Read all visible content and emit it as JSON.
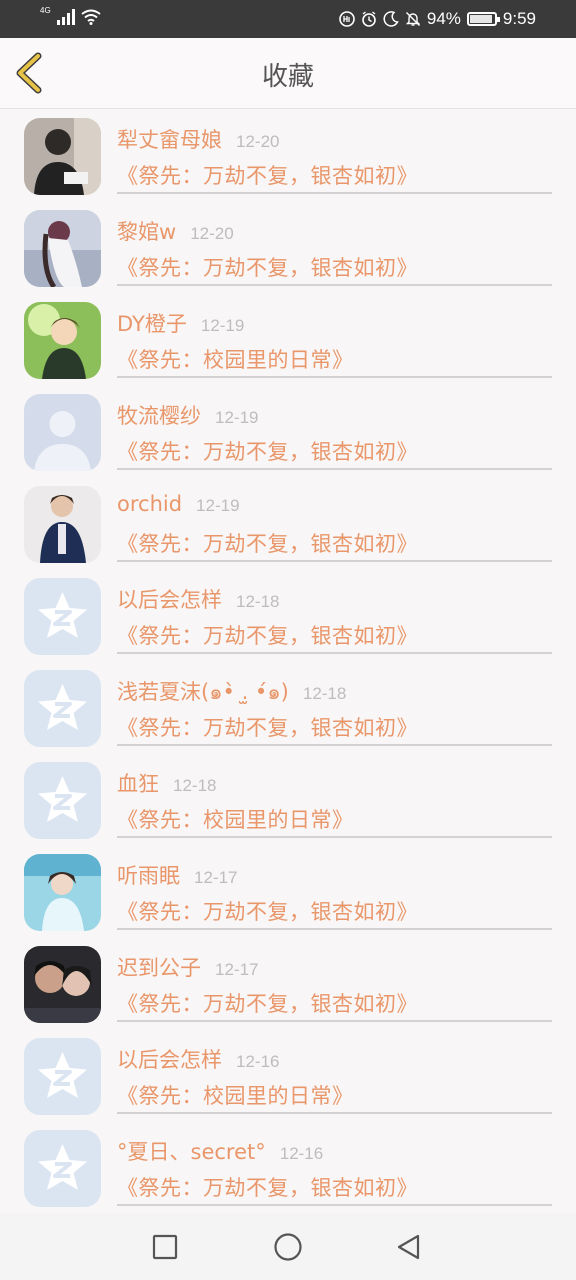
{
  "status_bar": {
    "network": "4G",
    "battery_percent": "94%",
    "battery_level": 0.94,
    "time": "9:59",
    "icons": [
      "signal-icon",
      "wifi-icon",
      "hd-icon",
      "alarm-icon",
      "moon-icon",
      "bell-off-icon",
      "battery-icon"
    ]
  },
  "header": {
    "title": "收藏",
    "back_icon": "chevron-left-icon",
    "accent_color": "#e6c248"
  },
  "favorites": [
    {
      "nickname": "犁丈畲母娘",
      "date": "12-20",
      "message": "《祭先：万劫不复，银杏如初》",
      "avatar": "photo-boy-desk"
    },
    {
      "nickname": "黎婠w",
      "date": "12-20",
      "message": "《祭先：万劫不复，银杏如初》",
      "avatar": "photo-girl-flower"
    },
    {
      "nickname": "DY橙子",
      "date": "12-19",
      "message": "《祭先：校园里的日常》",
      "avatar": "photo-anime-green"
    },
    {
      "nickname": "牧流樱纱",
      "date": "12-19",
      "message": "《祭先：万劫不复，银杏如初》",
      "avatar": "default-silhouette"
    },
    {
      "nickname": "orchid",
      "date": "12-19",
      "message": "《祭先：万劫不复，银杏如初》",
      "avatar": "photo-boy-jacket"
    },
    {
      "nickname": "以后会怎样",
      "date": "12-18",
      "message": "《祭先：万劫不复，银杏如初》",
      "avatar": "default-qzone-star"
    },
    {
      "nickname": "浅若夏沫(๑•̀ .̫ •́๑)",
      "date": "12-18",
      "message": "《祭先：万劫不复，银杏如初》",
      "avatar": "default-qzone-star"
    },
    {
      "nickname": "血狂",
      "date": "12-18",
      "message": "《祭先：校园里的日常》",
      "avatar": "default-qzone-star"
    },
    {
      "nickname": "听雨眠",
      "date": "12-17",
      "message": "《祭先：万劫不复，银杏如初》",
      "avatar": "photo-girl-blue"
    },
    {
      "nickname": "迟到公子",
      "date": "12-17",
      "message": "《祭先：万劫不复，银杏如初》",
      "avatar": "photo-couple"
    },
    {
      "nickname": "以后会怎样",
      "date": "12-16",
      "message": "《祭先：校园里的日常》",
      "avatar": "default-qzone-star"
    },
    {
      "nickname": "°夏日、secret°",
      "date": "12-16",
      "message": "《祭先：万劫不复，银杏如初》",
      "avatar": "default-qzone-star"
    }
  ],
  "colors": {
    "accent_text": "#e9976a",
    "date_text": "#bdbdbd",
    "background": "#f8f6f6"
  },
  "nav_bar": {
    "icons": [
      "recent-apps-square-icon",
      "home-circle-icon",
      "back-triangle-icon"
    ]
  }
}
